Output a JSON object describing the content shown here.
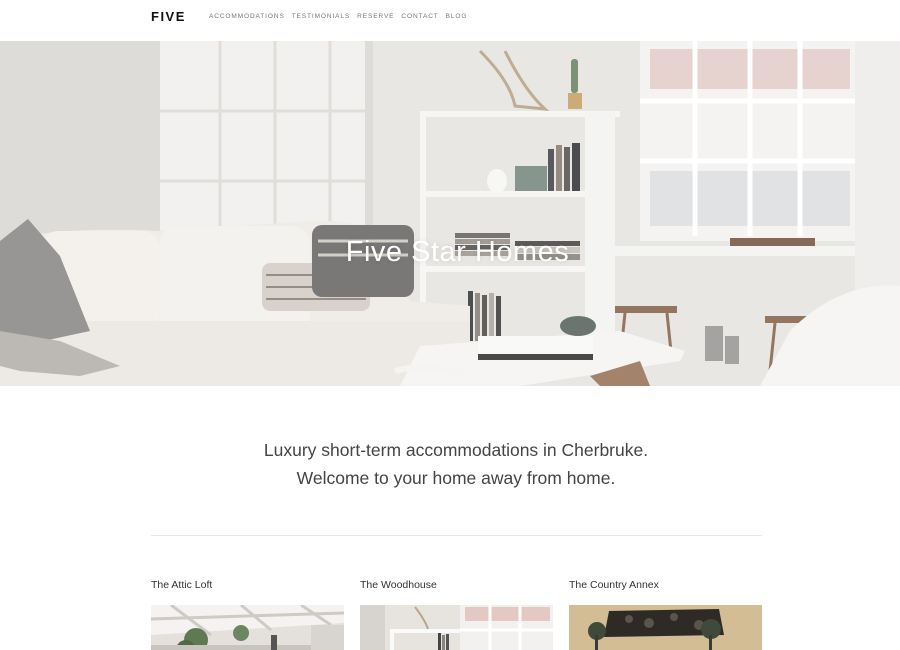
{
  "header": {
    "logo": "FIVE",
    "nav": [
      "ACCOMMODATIONS",
      "TESTIMONIALS",
      "RESERVE",
      "CONTACT",
      "BLOG"
    ]
  },
  "hero": {
    "title": "Five Star Homes"
  },
  "intro": {
    "line1": "Luxury short-term accommodations in Cherbruke.",
    "line2": "Welcome to your home away from home."
  },
  "listings": [
    {
      "name": "The Attic Loft"
    },
    {
      "name": "The Woodhouse"
    },
    {
      "name": "The Country Annex"
    }
  ],
  "colors": {
    "background": "#ffffff",
    "logo": "#111111",
    "nav_text": "#777777",
    "hero_title": "#ffffff",
    "body_text": "#444444",
    "divider": "#e6e6e6"
  }
}
